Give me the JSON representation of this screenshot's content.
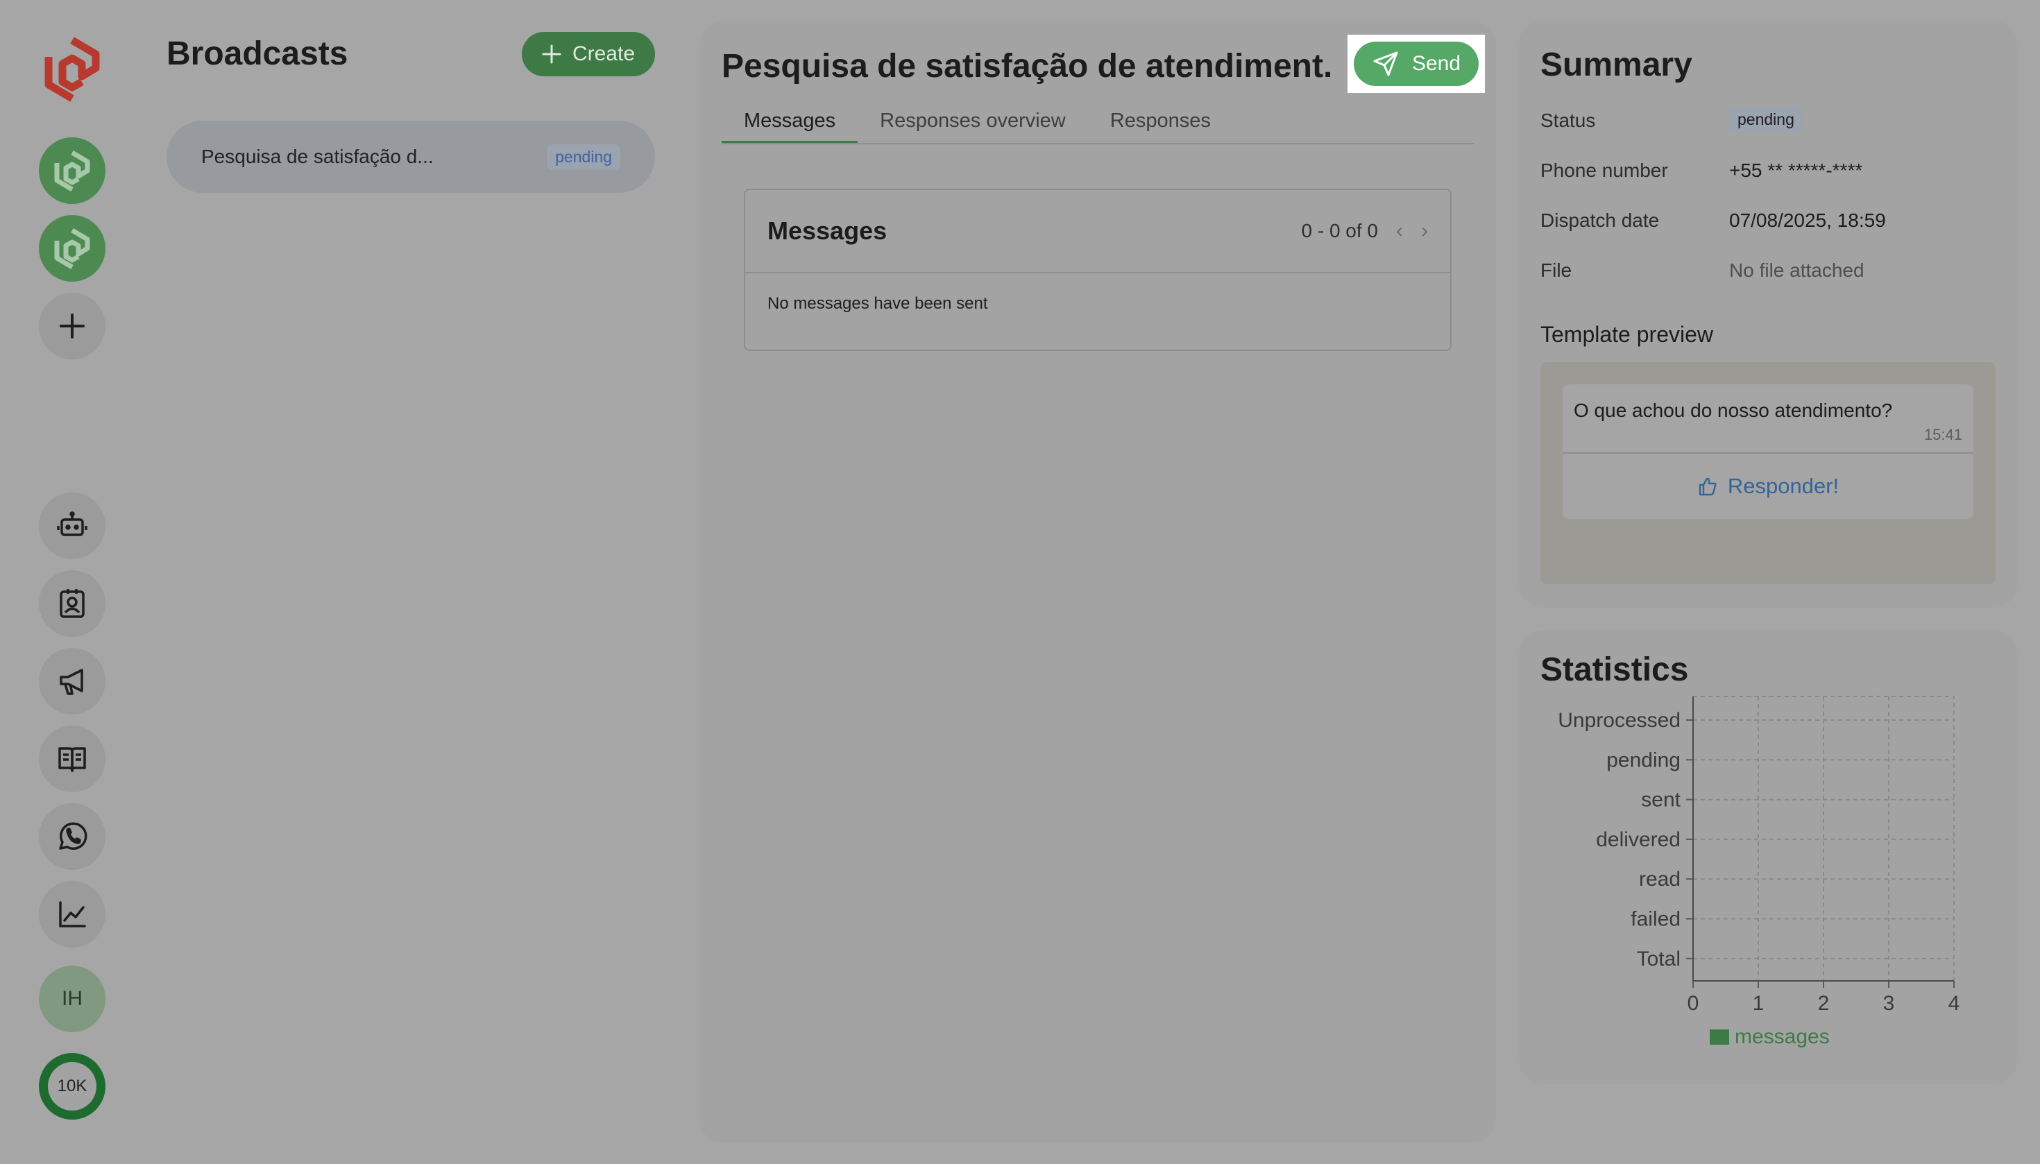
{
  "sidebar": {
    "icons": [
      {
        "name": "logo-icon",
        "color": "#b83a2e"
      },
      {
        "name": "org-icon-1",
        "color": "#4d8a52"
      },
      {
        "name": "org-icon-2",
        "color": "#4d8a52"
      },
      {
        "name": "add-icon"
      },
      {
        "name": "bot-icon"
      },
      {
        "name": "contacts-icon"
      },
      {
        "name": "megaphone-icon"
      },
      {
        "name": "book-icon"
      },
      {
        "name": "whatsapp-icon"
      },
      {
        "name": "chart-icon"
      }
    ],
    "user_initials": "IH",
    "quota_label": "10K"
  },
  "broadcasts": {
    "title": "Broadcasts",
    "create_label": "Create",
    "items": [
      {
        "name": "Pesquisa de satisfação d...",
        "status": "pending"
      }
    ]
  },
  "detail": {
    "title": "Pesquisa de satisfação de atendiment...",
    "send_label": "Send",
    "tabs": [
      {
        "label": "Messages",
        "active": true
      },
      {
        "label": "Responses overview",
        "active": false
      },
      {
        "label": "Responses",
        "active": false
      }
    ],
    "messages": {
      "title": "Messages",
      "pagination": "0 - 0 of 0",
      "empty_text": "No messages have been sent"
    }
  },
  "summary": {
    "title": "Summary",
    "rows": [
      {
        "label": "Status",
        "value": "pending"
      },
      {
        "label": "Phone number",
        "value": "+55 ** *****-****"
      },
      {
        "label": "Dispatch date",
        "value": "07/08/2025, 18:59"
      },
      {
        "label": "File",
        "value": "No file attached"
      }
    ],
    "template_title": "Template preview",
    "template": {
      "text": "O que achou do nosso atendimento?",
      "time": "15:41",
      "button_label": "Responder!"
    }
  },
  "statistics": {
    "title": "Statistics",
    "chart_data": {
      "type": "bar",
      "orientation": "horizontal",
      "categories": [
        "Unprocessed",
        "pending",
        "sent",
        "delivered",
        "read",
        "failed",
        "Total"
      ],
      "series": [
        {
          "name": "messages",
          "values": [
            0,
            0,
            0,
            0,
            0,
            0,
            0
          ]
        }
      ],
      "xticks": [
        "0",
        "1",
        "2",
        "3",
        "4"
      ],
      "xlim": [
        0,
        4
      ],
      "grid": true,
      "legend": "bottom",
      "color": "#3d7a46"
    }
  },
  "colors": {
    "accent_green": "#55a866",
    "brand_red": "#b83a2e",
    "pending_badge": "#3c63a0"
  }
}
